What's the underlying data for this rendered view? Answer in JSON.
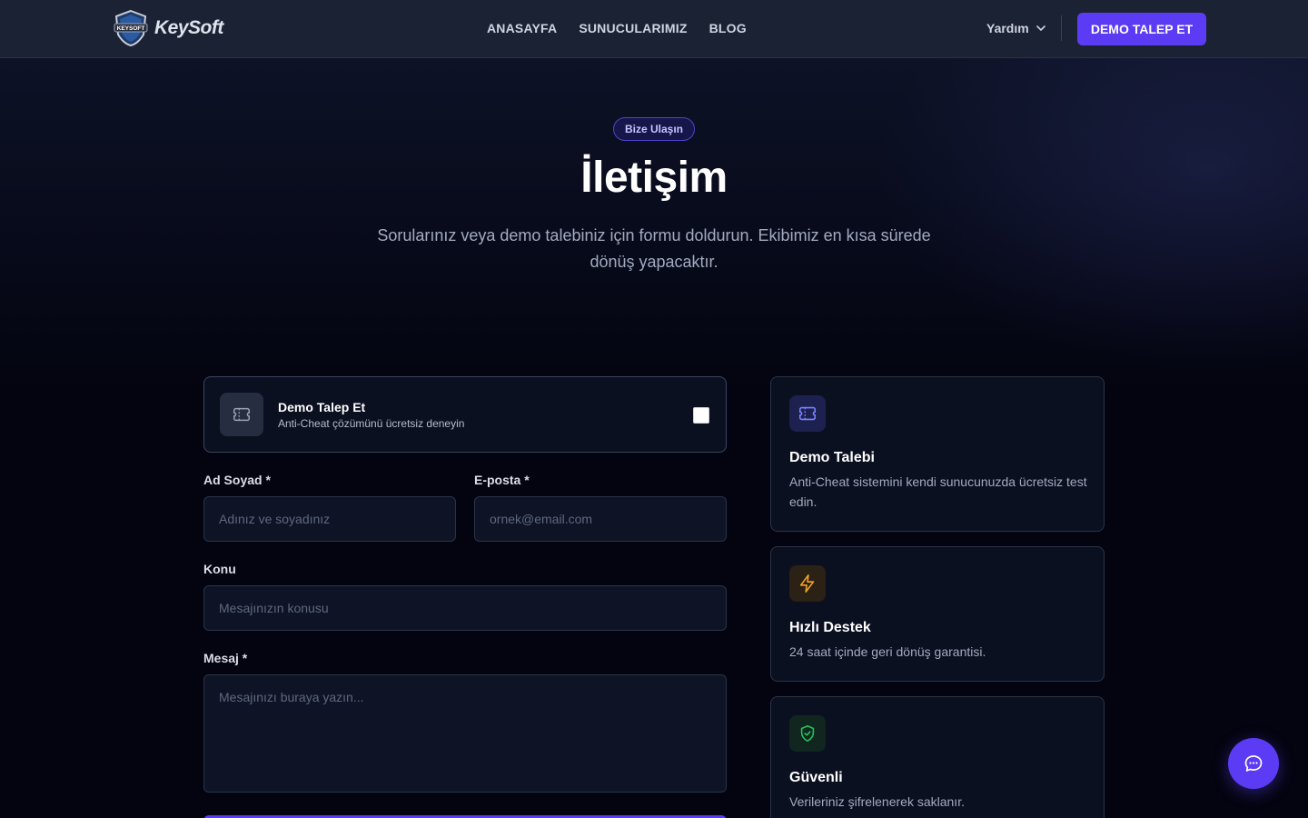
{
  "nav": {
    "logo_text": "KeySoft",
    "logo_badge_text": "KEYSOFT",
    "links": [
      "ANASAYFA",
      "SUNUCULARIMIZ",
      "BLOG"
    ],
    "help_label": "Yardım",
    "cta_label": "DEMO TALEP ET"
  },
  "hero": {
    "pill": "Bize Ulaşın",
    "title": "İletişim",
    "subtitle": "Sorularınız veya demo talebiniz için formu doldurun. Ekibimiz en kısa sürede dönüş yapacaktır."
  },
  "form": {
    "demo_card": {
      "title": "Demo Talep Et",
      "subtitle": "Anti-Cheat çözümünü ücretsiz deneyin",
      "checked": false
    },
    "name": {
      "label": "Ad Soyad *",
      "placeholder": "Adınız ve soyadınız"
    },
    "email": {
      "label": "E-posta *",
      "placeholder": "ornek@email.com"
    },
    "subject": {
      "label": "Konu",
      "placeholder": "Mesajınızın konusu"
    },
    "message": {
      "label": "Mesaj *",
      "placeholder": "Mesajınızı buraya yazın..."
    }
  },
  "info_cards": [
    {
      "icon": "ticket-icon",
      "title": "Demo Talebi",
      "text": "Anti-Cheat sistemini kendi sunucunuzda ücretsiz test edin."
    },
    {
      "icon": "lightning-icon",
      "title": "Hızlı Destek",
      "text": "24 saat içinde geri dönüş garantisi."
    },
    {
      "icon": "shield-check-icon",
      "title": "Güvenli",
      "text": "Verileriniz şifrelenerek saklanır."
    }
  ],
  "colors": {
    "accent": "#5b3cf4",
    "background": "#03040f",
    "nav_bg": "#1b2233",
    "icon_indigo": "#7c83ff",
    "icon_amber": "#f5a524",
    "icon_green": "#22c55e"
  },
  "chat": {
    "icon": "chat-bubble-icon"
  }
}
